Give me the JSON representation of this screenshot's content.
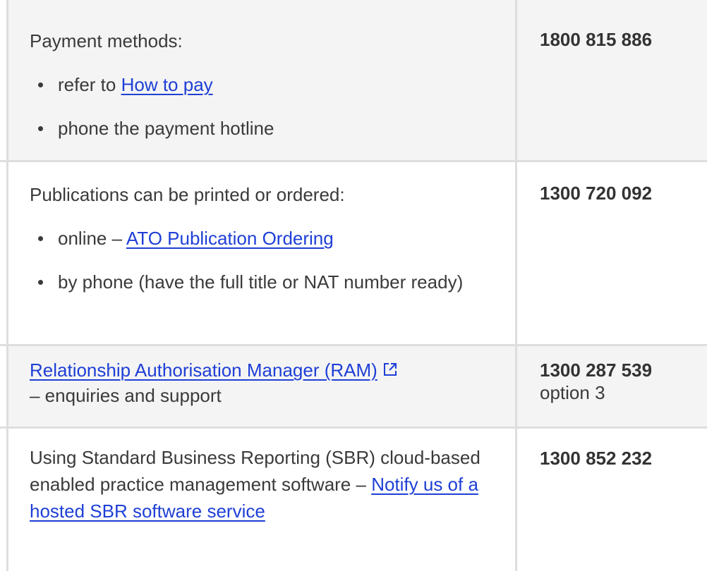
{
  "rows": [
    {
      "intro": "Payment methods:",
      "items": [
        {
          "prefix": "refer to ",
          "link": "How to pay",
          "suffix": ""
        },
        {
          "prefix": "phone the payment hotline",
          "link": "",
          "suffix": ""
        }
      ],
      "phone": "1800 815 886",
      "option": ""
    },
    {
      "intro": "Publications can be printed or ordered:",
      "items": [
        {
          "prefix": "online – ",
          "link": "ATO Publication Ordering",
          "suffix": ""
        },
        {
          "prefix": "by phone (have the full title or NAT number ready)",
          "link": "",
          "suffix": ""
        }
      ],
      "phone": "1300 720 092",
      "option": ""
    },
    {
      "link": "Relationship Authorisation Manager (RAM)",
      "link_icon": "external-link-icon",
      "text": "– enquiries and support",
      "phone": "1300 287 539",
      "option": "option 3"
    },
    {
      "text": "Using Standard Business Reporting (SBR) cloud-based enabled practice management software – ",
      "link": "Notify us of a hosted SBR software service",
      "phone": "1300 852 232",
      "option": ""
    }
  ],
  "colors": {
    "link": "#1e3fd6",
    "shaded_row": "#f4f4f4",
    "border": "#dedede"
  }
}
